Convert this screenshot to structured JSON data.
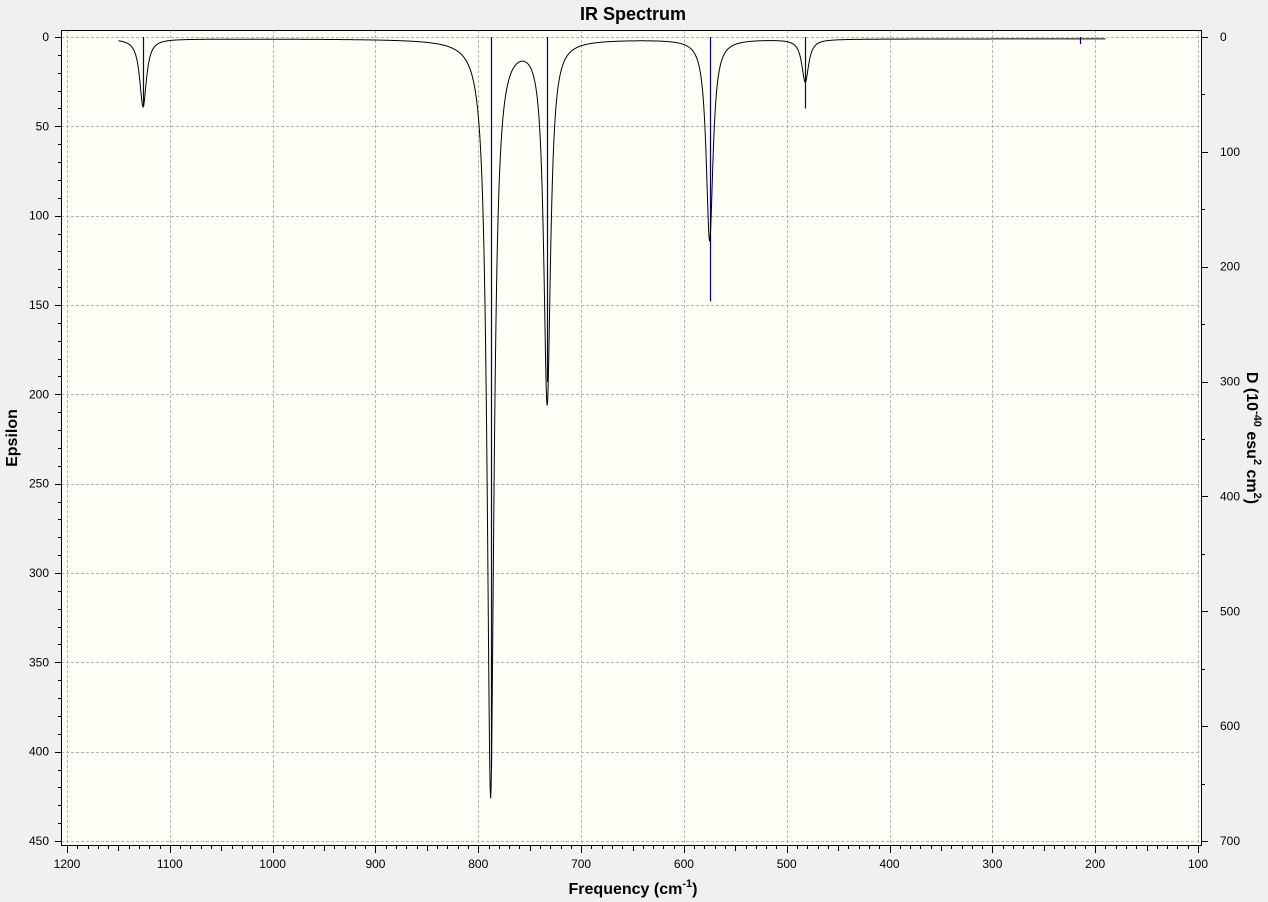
{
  "chart_data": {
    "type": "line",
    "title": "IR Spectrum",
    "xlabel": "Frequency (cm",
    "xlabel_sup": "-1",
    "xlabel_end": ")",
    "ylabel": "Epsilon",
    "y2label_parts": [
      "D (10",
      "-40",
      " esu",
      "2",
      " cm",
      "2",
      ")"
    ],
    "xlim": [
      1200,
      100
    ],
    "x_ticks": [
      "1200",
      "1100",
      "1000",
      "900",
      "800",
      "700",
      "600",
      "500",
      "400",
      "300",
      "200",
      "100"
    ],
    "x_tick_values": [
      1200,
      1100,
      1000,
      900,
      800,
      700,
      600,
      500,
      400,
      300,
      200,
      100
    ],
    "ylim": [
      0,
      450
    ],
    "y_ticks": [
      "0",
      "50",
      "100",
      "150",
      "200",
      "250",
      "300",
      "350",
      "400",
      "450"
    ],
    "y_tick_values": [
      0,
      50,
      100,
      150,
      200,
      250,
      300,
      350,
      400,
      450
    ],
    "y2lim": [
      0,
      700
    ],
    "y2_ticks": [
      "0",
      "100",
      "200",
      "300",
      "400",
      "500",
      "600",
      "700"
    ],
    "y2_tick_values": [
      0,
      100,
      200,
      300,
      400,
      500,
      600,
      700
    ],
    "grid": true,
    "spectrum_range": [
      1150,
      190
    ],
    "baseline": 1,
    "peaks": [
      {
        "freq": 1126,
        "height": 38,
        "hwhm": 4
      },
      {
        "freq": 788,
        "height": 424,
        "hwhm": 4
      },
      {
        "freq": 733,
        "height": 203,
        "hwhm": 4
      },
      {
        "freq": 575,
        "height": 113,
        "hwhm": 4
      },
      {
        "freq": 482,
        "height": 24,
        "hwhm": 4
      }
    ],
    "sticks": [
      {
        "freq": 1126,
        "intensity": 39
      },
      {
        "freq": 788,
        "intensity": 409
      },
      {
        "freq": 733,
        "intensity": 193
      },
      {
        "freq": 575,
        "intensity": 148
      },
      {
        "freq": 482,
        "intensity": 40
      },
      {
        "freq": 215,
        "intensity": 4
      }
    ],
    "colors": {
      "plot_bg": "#fefef6",
      "page_bg": "#f0f0f0",
      "curve": "#000000",
      "stick": "#000080",
      "grid": "#b4b4b4"
    }
  }
}
